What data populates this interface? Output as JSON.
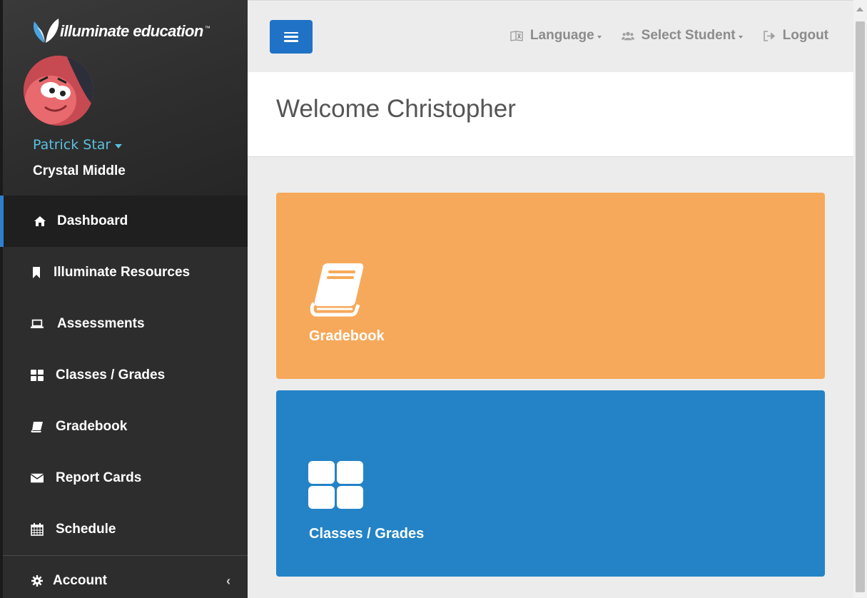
{
  "brand": {
    "logo_text": "illuminate education",
    "tm": "™"
  },
  "user": {
    "name": "Patrick Star",
    "school": "Crystal Middle"
  },
  "sidebar": {
    "items": [
      {
        "label": "Dashboard",
        "icon": "home-icon",
        "active": true
      },
      {
        "label": "Illuminate Resources",
        "icon": "bookmark-icon"
      },
      {
        "label": "Assessments",
        "icon": "laptop-icon"
      },
      {
        "label": "Classes / Grades",
        "icon": "grid-icon"
      },
      {
        "label": "Gradebook",
        "icon": "book-icon"
      },
      {
        "label": "Report Cards",
        "icon": "envelope-icon"
      },
      {
        "label": "Schedule",
        "icon": "calendar-icon"
      },
      {
        "label": "Account",
        "icon": "gear-icon"
      }
    ],
    "account_chevron": "‹"
  },
  "topbar": {
    "language_label": "Language",
    "select_student_label": "Select Student",
    "logout_label": "Logout"
  },
  "welcome": {
    "title": "Welcome Christopher"
  },
  "tiles": [
    {
      "label": "Gradebook",
      "icon": "book-icon",
      "color": "#f6a95a"
    },
    {
      "label": "Classes / Grades",
      "icon": "grid-icon",
      "color": "#2383c6"
    }
  ],
  "colors": {
    "sidebar_bg": "#2d2d2d",
    "accent_blue": "#1f72c5",
    "user_link": "#5bc0de"
  }
}
